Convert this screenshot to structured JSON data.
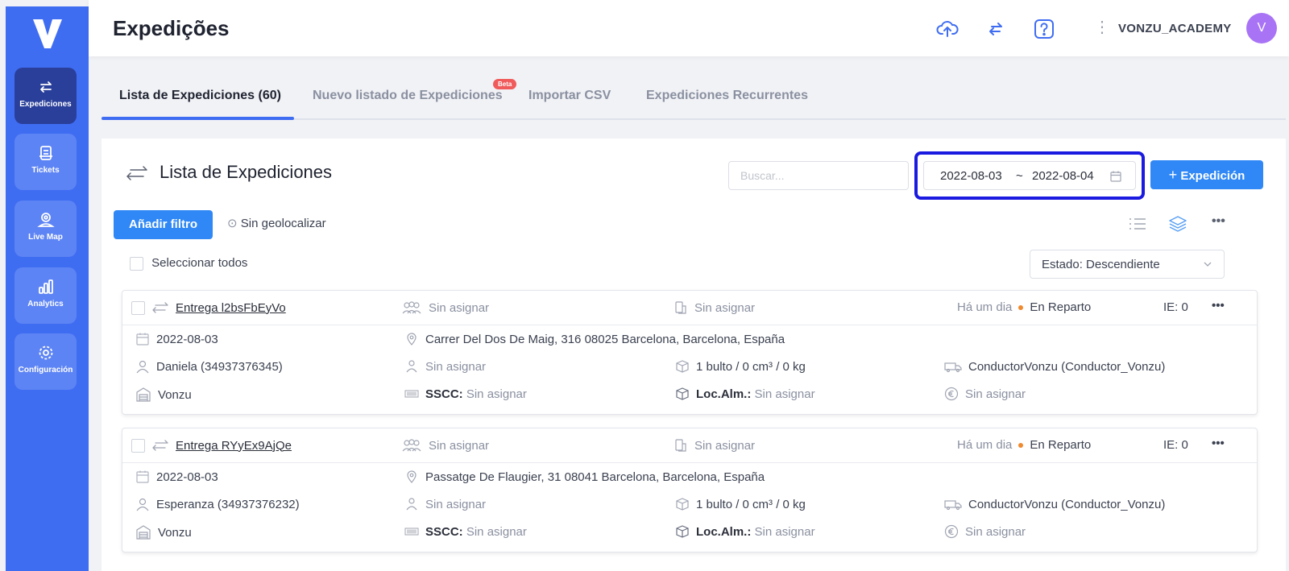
{
  "sidebar": {
    "items": [
      {
        "label": "Expediciones",
        "icon": "arrows-swap-icon",
        "active": true
      },
      {
        "label": "Tickets",
        "icon": "ticket-icon"
      },
      {
        "label": "Live Map",
        "icon": "map-pin-icon"
      },
      {
        "label": "Analytics",
        "icon": "bar-chart-icon"
      },
      {
        "label": "Configuración",
        "icon": "gear-icon"
      }
    ]
  },
  "header": {
    "title": "Expedições",
    "username": "VONZU_ACADEMY",
    "avatar_initial": "V"
  },
  "tabs": [
    {
      "label": "Lista de Expediciones (60)",
      "active": true
    },
    {
      "label": "Nuevo listado de Expediciones",
      "badge": "Beta"
    },
    {
      "label": "Importar CSV"
    },
    {
      "label": "Expediciones Recurrentes"
    }
  ],
  "list": {
    "title": "Lista de Expediciones",
    "search_placeholder": "Buscar...",
    "date_from": "2022-08-03",
    "date_sep": "~",
    "date_to": "2022-08-04",
    "new_button": "Expedición",
    "filter_button": "Añadir filtro",
    "geo_label": "Sin geolocalizar",
    "select_all": "Seleccionar todos",
    "sort_label": "Estado: Descendiente"
  },
  "shipments": [
    {
      "name": "Entrega l2bsFbEyVo",
      "group": "Sin asignar",
      "route": "Sin asignar",
      "time": "Há um dia",
      "status": "En Reparto",
      "ie": "IE: 0",
      "date": "2022-08-03",
      "address": "Carrer Del Dos De Maig, 316 08025 Barcelona, Barcelona, España",
      "contact": "Daniela (34937376345)",
      "assignee": "Sin asignar",
      "package": "1 bulto / 0 cm³ / 0 kg",
      "driver": "ConductorVonzu (Conductor_Vonzu)",
      "warehouse": "Vonzu",
      "sscc_label": "SSCC:",
      "sscc_value": "Sin asignar",
      "loc_label": "Loc.Alm.:",
      "loc_value": "Sin asignar",
      "price": "Sin asignar"
    },
    {
      "name": "Entrega RYyEx9AjQe",
      "group": "Sin asignar",
      "route": "Sin asignar",
      "time": "Há um dia",
      "status": "En Reparto",
      "ie": "IE: 0",
      "date": "2022-08-03",
      "address": "Passatge De Flaugier, 31 08041 Barcelona, Barcelona, España",
      "contact": "Esperanza (34937376232)",
      "assignee": "Sin asignar",
      "package": "1 bulto / 0 cm³ / 0 kg",
      "driver": "ConductorVonzu (Conductor_Vonzu)",
      "warehouse": "Vonzu",
      "sscc_label": "SSCC:",
      "sscc_value": "Sin asignar",
      "loc_label": "Loc.Alm.:",
      "loc_value": "Sin asignar",
      "price": "Sin asignar"
    }
  ],
  "colors": {
    "sidebar": "#3f6df2",
    "primary_button": "#2f88f5",
    "status_dot": "#f08a2e",
    "highlight": "#1a1ae0"
  }
}
